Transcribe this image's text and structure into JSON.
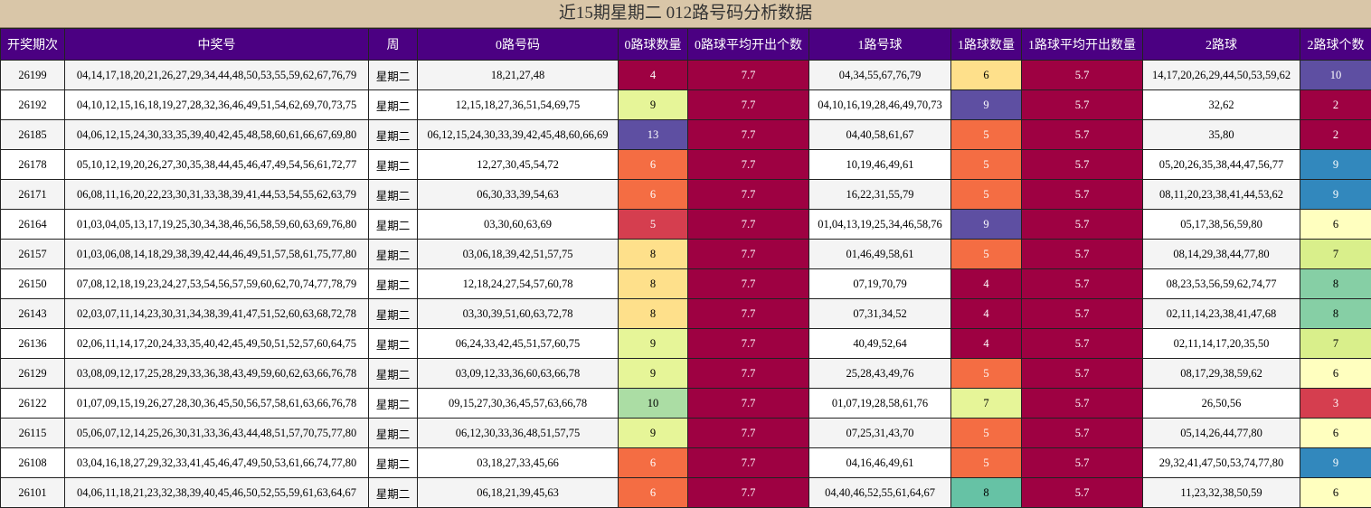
{
  "title": "近15期星期二 012路号码分析数据",
  "headers": {
    "period": "开奖期次",
    "numbers": "中奖号",
    "weekday": "周",
    "route0": "0路号码",
    "route0_count": "0路球数量",
    "route0_avg": "0路球平均开出个数",
    "route1": "1路号球",
    "route1_count": "1路球数量",
    "route1_avg": "1路球平均开出数量",
    "route2": "2路球",
    "route2_count": "2路球个数"
  },
  "colors": {
    "header_bg": "#4b0082",
    "title_bg": "#d9c6a8",
    "avg_bg": "#9e0142"
  },
  "rows": [
    {
      "period": "26199",
      "numbers": "04,14,17,18,20,21,26,27,29,34,44,48,50,53,55,59,62,67,76,79",
      "weekday": "星期二",
      "r0": "18,21,27,48",
      "c0": "4",
      "a0": "7.7",
      "r1": "04,34,55,67,76,79",
      "c1": "6",
      "a1": "5.7",
      "r2": "14,17,20,26,29,44,50,53,59,62",
      "c2": "10"
    },
    {
      "period": "26192",
      "numbers": "04,10,12,15,16,18,19,27,28,32,36,46,49,51,54,62,69,70,73,75",
      "weekday": "星期二",
      "r0": "12,15,18,27,36,51,54,69,75",
      "c0": "9",
      "a0": "7.7",
      "r1": "04,10,16,19,28,46,49,70,73",
      "c1": "9",
      "a1": "5.7",
      "r2": "32,62",
      "c2": "2"
    },
    {
      "period": "26185",
      "numbers": "04,06,12,15,24,30,33,35,39,40,42,45,48,58,60,61,66,67,69,80",
      "weekday": "星期二",
      "r0": "06,12,15,24,30,33,39,42,45,48,60,66,69",
      "c0": "13",
      "a0": "7.7",
      "r1": "04,40,58,61,67",
      "c1": "5",
      "a1": "5.7",
      "r2": "35,80",
      "c2": "2"
    },
    {
      "period": "26178",
      "numbers": "05,10,12,19,20,26,27,30,35,38,44,45,46,47,49,54,56,61,72,77",
      "weekday": "星期二",
      "r0": "12,27,30,45,54,72",
      "c0": "6",
      "a0": "7.7",
      "r1": "10,19,46,49,61",
      "c1": "5",
      "a1": "5.7",
      "r2": "05,20,26,35,38,44,47,56,77",
      "c2": "9"
    },
    {
      "period": "26171",
      "numbers": "06,08,11,16,20,22,23,30,31,33,38,39,41,44,53,54,55,62,63,79",
      "weekday": "星期二",
      "r0": "06,30,33,39,54,63",
      "c0": "6",
      "a0": "7.7",
      "r1": "16,22,31,55,79",
      "c1": "5",
      "a1": "5.7",
      "r2": "08,11,20,23,38,41,44,53,62",
      "c2": "9"
    },
    {
      "period": "26164",
      "numbers": "01,03,04,05,13,17,19,25,30,34,38,46,56,58,59,60,63,69,76,80",
      "weekday": "星期二",
      "r0": "03,30,60,63,69",
      "c0": "5",
      "a0": "7.7",
      "r1": "01,04,13,19,25,34,46,58,76",
      "c1": "9",
      "a1": "5.7",
      "r2": "05,17,38,56,59,80",
      "c2": "6"
    },
    {
      "period": "26157",
      "numbers": "01,03,06,08,14,18,29,38,39,42,44,46,49,51,57,58,61,75,77,80",
      "weekday": "星期二",
      "r0": "03,06,18,39,42,51,57,75",
      "c0": "8",
      "a0": "7.7",
      "r1": "01,46,49,58,61",
      "c1": "5",
      "a1": "5.7",
      "r2": "08,14,29,38,44,77,80",
      "c2": "7"
    },
    {
      "period": "26150",
      "numbers": "07,08,12,18,19,23,24,27,53,54,56,57,59,60,62,70,74,77,78,79",
      "weekday": "星期二",
      "r0": "12,18,24,27,54,57,60,78",
      "c0": "8",
      "a0": "7.7",
      "r1": "07,19,70,79",
      "c1": "4",
      "a1": "5.7",
      "r2": "08,23,53,56,59,62,74,77",
      "c2": "8"
    },
    {
      "period": "26143",
      "numbers": "02,03,07,11,14,23,30,31,34,38,39,41,47,51,52,60,63,68,72,78",
      "weekday": "星期二",
      "r0": "03,30,39,51,60,63,72,78",
      "c0": "8",
      "a0": "7.7",
      "r1": "07,31,34,52",
      "c1": "4",
      "a1": "5.7",
      "r2": "02,11,14,23,38,41,47,68",
      "c2": "8"
    },
    {
      "period": "26136",
      "numbers": "02,06,11,14,17,20,24,33,35,40,42,45,49,50,51,52,57,60,64,75",
      "weekday": "星期二",
      "r0": "06,24,33,42,45,51,57,60,75",
      "c0": "9",
      "a0": "7.7",
      "r1": "40,49,52,64",
      "c1": "4",
      "a1": "5.7",
      "r2": "02,11,14,17,20,35,50",
      "c2": "7"
    },
    {
      "period": "26129",
      "numbers": "03,08,09,12,17,25,28,29,33,36,38,43,49,59,60,62,63,66,76,78",
      "weekday": "星期二",
      "r0": "03,09,12,33,36,60,63,66,78",
      "c0": "9",
      "a0": "7.7",
      "r1": "25,28,43,49,76",
      "c1": "5",
      "a1": "5.7",
      "r2": "08,17,29,38,59,62",
      "c2": "6"
    },
    {
      "period": "26122",
      "numbers": "01,07,09,15,19,26,27,28,30,36,45,50,56,57,58,61,63,66,76,78",
      "weekday": "星期二",
      "r0": "09,15,27,30,36,45,57,63,66,78",
      "c0": "10",
      "a0": "7.7",
      "r1": "01,07,19,28,58,61,76",
      "c1": "7",
      "a1": "5.7",
      "r2": "26,50,56",
      "c2": "3"
    },
    {
      "period": "26115",
      "numbers": "05,06,07,12,14,25,26,30,31,33,36,43,44,48,51,57,70,75,77,80",
      "weekday": "星期二",
      "r0": "06,12,30,33,36,48,51,57,75",
      "c0": "9",
      "a0": "7.7",
      "r1": "07,25,31,43,70",
      "c1": "5",
      "a1": "5.7",
      "r2": "05,14,26,44,77,80",
      "c2": "6"
    },
    {
      "period": "26108",
      "numbers": "03,04,16,18,27,29,32,33,41,45,46,47,49,50,53,61,66,74,77,80",
      "weekday": "星期二",
      "r0": "03,18,27,33,45,66",
      "c0": "6",
      "a0": "7.7",
      "r1": "04,16,46,49,61",
      "c1": "5",
      "a1": "5.7",
      "r2": "29,32,41,47,50,53,74,77,80",
      "c2": "9"
    },
    {
      "period": "26101",
      "numbers": "04,06,11,18,21,23,32,38,39,40,45,46,50,52,55,59,61,63,64,67",
      "weekday": "星期二",
      "r0": "06,18,21,39,45,63",
      "c0": "6",
      "a0": "7.7",
      "r1": "04,40,46,52,55,61,64,67",
      "c1": "8",
      "a1": "5.7",
      "r2": "11,23,32,38,50,59",
      "c2": "6"
    }
  ]
}
